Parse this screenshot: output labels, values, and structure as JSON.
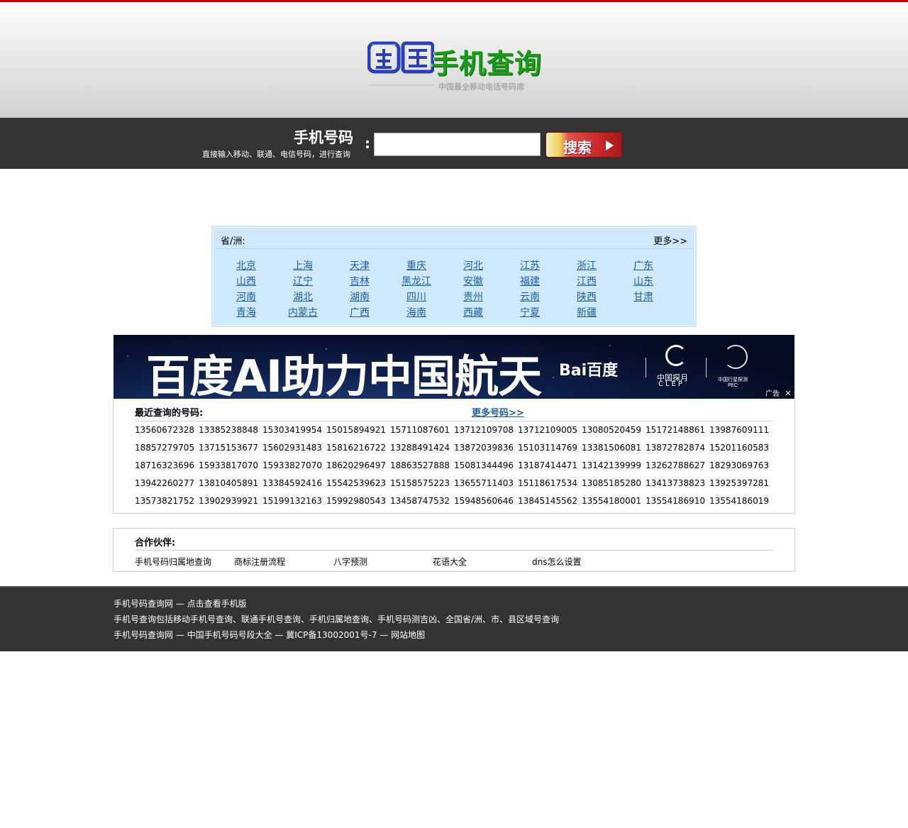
{
  "logo": {
    "quan": "全国",
    "main": "手机查询",
    "tagline": "中国最全移动电话号码库"
  },
  "search": {
    "title": "手机号码",
    "hint": "直接输入移动、联通、电信号码，进行查询",
    "colon": ":",
    "value": "",
    "button_label": "搜索"
  },
  "provinces": {
    "title": "省/洲:",
    "more": "更多>>",
    "items": [
      "北京",
      "上海",
      "天津",
      "重庆",
      "河北",
      "江苏",
      "浙江",
      "广东",
      "山西",
      "辽宁",
      "吉林",
      "黑龙江",
      "安徽",
      "福建",
      "江西",
      "山东",
      "河南",
      "湖北",
      "湖南",
      "四川",
      "贵州",
      "云南",
      "陕西",
      "甘肃",
      "青海",
      "内蒙古",
      "广西",
      "海南",
      "西藏",
      "宁夏",
      "新疆"
    ]
  },
  "banner": {
    "headline": "百度AI助力中国航天",
    "brand": "Bai百度",
    "clep_cn": "中国探月",
    "clep_en": "CLEP",
    "pec_cn": "中国行星探测",
    "pec_en": "PEC",
    "ad_label": "广告",
    "close": "✕"
  },
  "recent": {
    "title": "最近查询的号码:",
    "more": "更多号码>>",
    "numbers": [
      "13560672328",
      "13385238848",
      "15303419954",
      "15015894921",
      "15711087601",
      "13712109708",
      "13712109005",
      "13080520459",
      "15172148861",
      "13987609111",
      "18857279705",
      "13715153677",
      "15602931483",
      "15816216722",
      "13288491424",
      "13872039836",
      "15103114769",
      "13381506081",
      "13872782874",
      "15201160583",
      "18716323696",
      "15933817070",
      "15933827070",
      "18620296497",
      "18863527888",
      "15081344496",
      "13187414471",
      "13142139999",
      "13262788627",
      "18293069763",
      "13942260277",
      "13810405891",
      "13384592416",
      "15542539623",
      "15158575223",
      "13655711403",
      "15118617534",
      "13085185280",
      "13413738823",
      "13925397281",
      "13573821752",
      "13902939921",
      "15199132163",
      "15992980543",
      "13458747532",
      "15948560646",
      "13845145562",
      "13554180001",
      "13554186910",
      "13554186019"
    ]
  },
  "partners": {
    "title": "合作伙伴:",
    "items": [
      "手机号码归属地查询",
      "商标注册流程",
      "八字预测",
      "花语大全",
      "dns怎么设置"
    ]
  },
  "footer": {
    "line1": "手机号码查询网 — 点击查看手机版",
    "line2": "手机号查询包括移动手机号查询、联通手机号查询、手机归属地查询、手机号码测吉凶、全国省/洲、市、县区域号查询",
    "line3": "手机号码查询网 — 中国手机号码号段大全 — 冀ICP备13002001号-7 — 网站地图"
  },
  "colors": {
    "top_accent": "#cc0000",
    "dark_bar": "#333333",
    "link_blue": "#1f5f9e",
    "province_bg": "#cfe8fb",
    "logo_green": "#1c9a1c",
    "logo_blue": "#2a3fb8"
  }
}
